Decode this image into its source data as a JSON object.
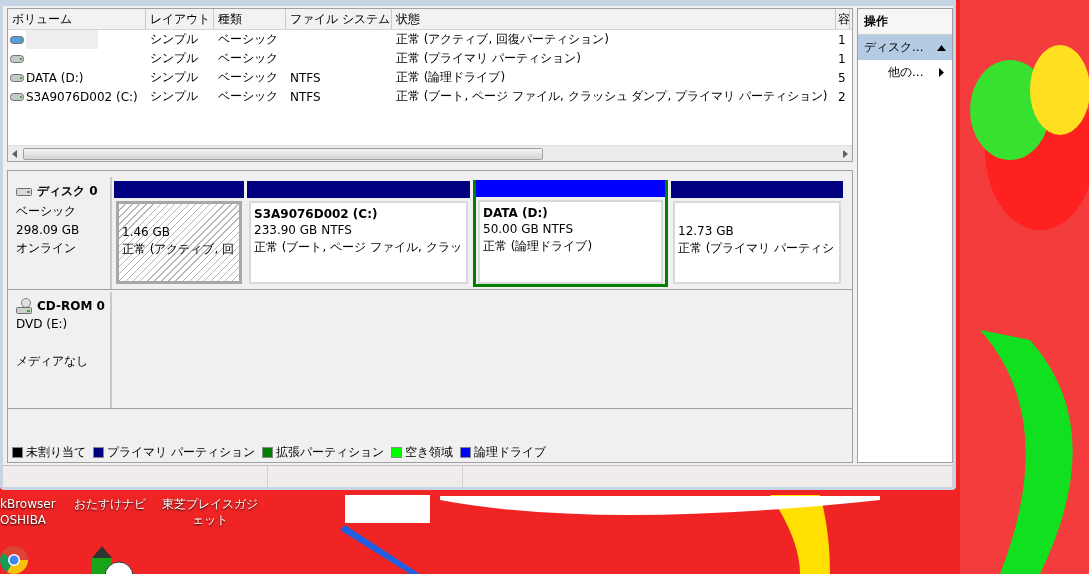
{
  "volume_table": {
    "columns": [
      "ボリューム",
      "レイアウト",
      "種類",
      "ファイル システム",
      "状態",
      "容"
    ],
    "rows": [
      {
        "kind": "system",
        "redacted": true,
        "layout": "シンプル",
        "type": "ベーシック",
        "status": "正常 (アクティブ, 回復パーティション)",
        "column_6": "1"
      },
      {
        "kind": "drive",
        "redacted": false,
        "layout": "シンプル",
        "type": "ベーシック",
        "status": "正常 (プライマリ パーティション)",
        "column_6": "1"
      },
      {
        "kind": "drive",
        "redacted": false,
        "volume": "DATA (D:)",
        "layout": "シンプル",
        "type": "ベーシック",
        "file_system": "NTFS",
        "status": "正常 (論理ドライブ)",
        "column_6": "5"
      },
      {
        "kind": "drive",
        "redacted": false,
        "volume": "S3A9076D002 (C:)",
        "layout": "シンプル",
        "type": "ベーシック",
        "file_system": "NTFS",
        "status": "正常 (ブート, ページ ファイル, クラッシュ ダンプ, プライマリ パーティション)",
        "column_6": "2"
      }
    ]
  },
  "disks": [
    {
      "kind": "hdd",
      "name": "ディスク 0",
      "type": "ベーシック",
      "size": "298.09 GB",
      "status": "オンライン",
      "partitions": [
        {
          "kind": "primary",
          "selected": true,
          "extended": false,
          "size": "1.46 GB",
          "status": "正常 (アクティブ, 回"
        },
        {
          "kind": "primary",
          "selected": false,
          "extended": false,
          "name": "S3A9076D002  (C:)",
          "size": "233.90 GB NTFS",
          "status": "正常 (ブート, ページ ファイル, クラッ"
        },
        {
          "kind": "logical",
          "selected": false,
          "extended": true,
          "name": "DATA  (D:)",
          "size": "50.00 GB NTFS",
          "status": "正常 (論理ドライブ)"
        },
        {
          "kind": "primary",
          "selected": false,
          "extended": false,
          "size": "12.73 GB",
          "status": "正常 (プライマリ パーティシ"
        }
      ]
    },
    {
      "kind": "cdrom",
      "name": "CD-ROM 0",
      "type": "DVD (E:)",
      "status": "メディアなし"
    }
  ],
  "legend": [
    {
      "label": "未割り当て",
      "color": "#000000"
    },
    {
      "label": "プライマリ パーティション",
      "color": "#000080"
    },
    {
      "label": "拡張パーティション",
      "color": "#008000"
    },
    {
      "label": "空き領域",
      "color": "#00ff00"
    },
    {
      "label": "論理ドライブ",
      "color": "#0000ff"
    }
  ],
  "actions": {
    "title": "操作",
    "items": [
      {
        "kind": "group",
        "label": "ディスク...",
        "selected": true
      },
      {
        "kind": "submenu",
        "label": "他の...",
        "selected": false
      }
    ]
  },
  "desktop_icons": [
    {
      "kind": "browser",
      "lines": [
        "kBrowser",
        "OSHIBA"
      ]
    },
    {
      "kind": "pencil",
      "lines": [
        "おたすけナビ"
      ]
    },
    {
      "kind": "none",
      "lines": [
        "東芝プレイスガジ",
        "ェット"
      ]
    }
  ]
}
